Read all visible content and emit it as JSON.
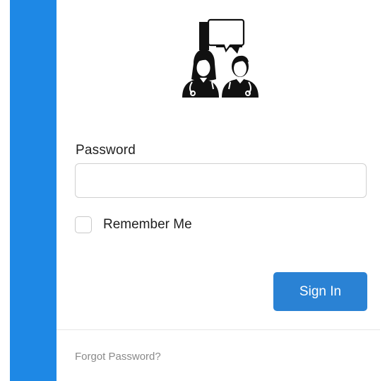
{
  "login": {
    "password_label": "Password",
    "password_value": "",
    "password_placeholder": "",
    "remember_label": "Remember Me",
    "remember_checked": false,
    "sign_in_label": "Sign In",
    "forgot_label": "Forgot Password?"
  },
  "logo": {
    "icon": "doctors-chat-icon"
  },
  "colors": {
    "sidebar": "#1e88e5",
    "button": "#2a82d4",
    "link": "#8a8a8a"
  }
}
